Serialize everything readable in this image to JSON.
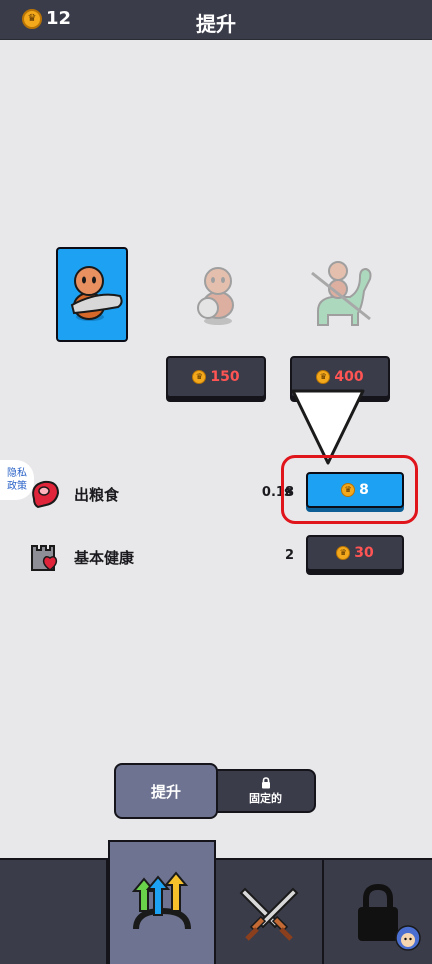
{
  "header": {
    "coin_count": "12",
    "title": "提升"
  },
  "units": [
    {
      "name": "club-caveman",
      "state": "selected"
    },
    {
      "name": "shield-caveman",
      "state": "locked",
      "cost": "150"
    },
    {
      "name": "dino-rider",
      "state": "locked",
      "cost": "400"
    }
  ],
  "privacy": {
    "line1": "隐私",
    "line2": "政策"
  },
  "upgrades": [
    {
      "label": "出粮食",
      "value": "0.18",
      "unit": "s",
      "cost": "8",
      "icon": "meat-icon",
      "style": "available"
    },
    {
      "label": "基本健康",
      "value": "2",
      "unit": "",
      "cost": "30",
      "icon": "castle-heart-icon",
      "style": "unaffordable"
    }
  ],
  "tabs": {
    "upgrade_label": "提升",
    "fixed_label": "固定的"
  },
  "bottom_nav": [
    {
      "name": "upgrade",
      "icon": "upgrade-arrows-icon",
      "active": true
    },
    {
      "name": "battle",
      "icon": "crossed-swords-icon",
      "active": false
    },
    {
      "name": "locked",
      "icon": "padlock-icon",
      "active": false
    }
  ],
  "colors": {
    "accent_blue": "#1da1f2",
    "panel_dark": "#3a3c4a",
    "cost_red": "#ff5454",
    "coin_gold": "#f3a91b",
    "highlight_red": "#e0141b"
  }
}
